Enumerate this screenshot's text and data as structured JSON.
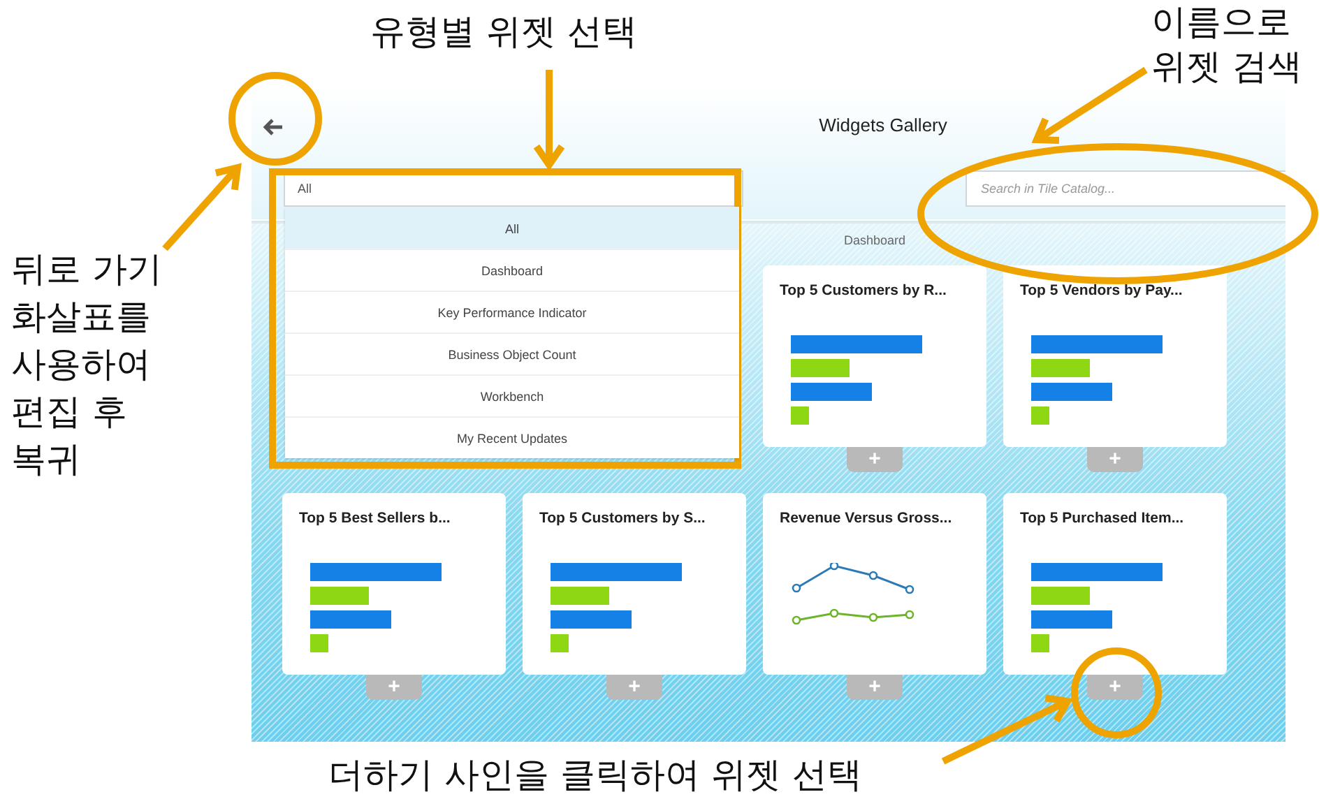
{
  "window": {
    "title": "Widgets Gallery"
  },
  "type_filter": {
    "value": "All",
    "options": [
      {
        "label": "All",
        "selected": true
      },
      {
        "label": "Dashboard",
        "selected": false
      },
      {
        "label": "Key Performance Indicator",
        "selected": false
      },
      {
        "label": "Business Object Count",
        "selected": false
      },
      {
        "label": "Workbench",
        "selected": false
      },
      {
        "label": "My Recent Updates",
        "selected": false
      }
    ]
  },
  "search": {
    "placeholder": "Search in Tile Catalog..."
  },
  "section_label": "Dashboard",
  "widgets": [
    {
      "title": "Top 5 Customers by R...",
      "kind": "bar",
      "hidden": false,
      "add_label": "+"
    },
    {
      "title": "Top 5 Vendors by Pay...",
      "kind": "bar",
      "hidden": false,
      "add_label": "+"
    },
    {
      "title": "Top 5 Best Sellers b...",
      "kind": "bar",
      "hidden": false,
      "add_label": "+"
    },
    {
      "title": "Top 5 Customers by S...",
      "kind": "bar",
      "hidden": false,
      "add_label": "+"
    },
    {
      "title": "Revenue Versus Gross...",
      "kind": "line",
      "hidden": false,
      "add_label": "+"
    },
    {
      "title": "Top 5 Purchased Item...",
      "kind": "bar",
      "hidden": false,
      "add_label": "+"
    }
  ],
  "annotations": {
    "type_select": [
      "유형별 위젯 선택"
    ],
    "search_by_name": [
      "이름으로",
      "위젯 검색"
    ],
    "back": [
      "뒤로 가기",
      "화살표를",
      "사용하여",
      "편집 후",
      "복귀"
    ],
    "add": [
      "더하기 사인을 클릭하여 위젯 선택"
    ]
  }
}
